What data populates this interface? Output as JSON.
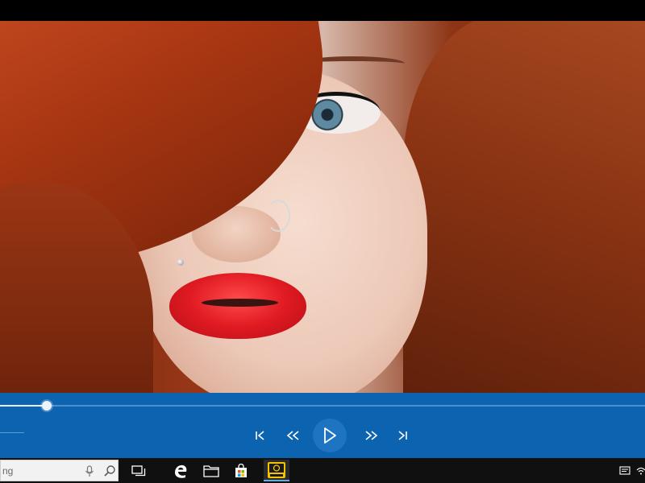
{
  "video": {
    "description_icon": "video-frame"
  },
  "player": {
    "accent_color": "#0c63b0",
    "progress": 0.073,
    "controls": [
      {
        "id": "previous",
        "icon": "skip-previous-icon"
      },
      {
        "id": "rewind",
        "icon": "rewind-icon"
      },
      {
        "id": "play",
        "icon": "play-icon"
      },
      {
        "id": "fast_forward",
        "icon": "fast-forward-icon"
      },
      {
        "id": "next",
        "icon": "skip-next-icon"
      }
    ]
  },
  "taskbar": {
    "search_text": "ng",
    "items": [
      {
        "icon": "task-view-icon"
      },
      {
        "icon": "edge-browser-icon"
      },
      {
        "icon": "file-explorer-icon"
      },
      {
        "icon": "store-icon"
      },
      {
        "icon": "media-player-app-icon"
      }
    ],
    "tray": [
      {
        "icon": "message-icon"
      },
      {
        "icon": "wifi-icon"
      }
    ]
  }
}
